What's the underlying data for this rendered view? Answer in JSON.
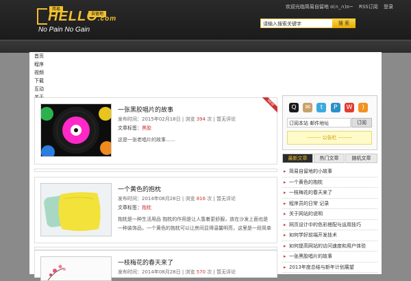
{
  "header": {
    "logo_text": "HELLO",
    "logo_badge_left": "简易",
    "logo_badge_right": "自留地",
    "logo_com": ".com",
    "tagline": "No Pain No Gain",
    "top_text": "欢迎光临简易自留地 o(∩_∩)o~",
    "rss_label": "RSS订阅",
    "login_label": "登录"
  },
  "search": {
    "placeholder": "请输入搜索关键字",
    "button_label": "搜 索"
  },
  "menu": [
    "首页",
    "程序",
    "视频",
    "下载",
    "互动",
    "关于"
  ],
  "posts": [
    {
      "title": "一张黑胶唱片的故事",
      "date_label": "发布时间：2015年02月18日",
      "views_prefix": "浏览",
      "views": "394",
      "views_suffix": "次",
      "comments_label": "暂无评论",
      "tags_label": "文章标签：",
      "tag": "黑胶",
      "description": "这是一张老唱片的故事……",
      "badge": "NEW"
    },
    {
      "title": "一个黄色的抱枕",
      "date_label": "发布时间：2014年08月28日",
      "views_prefix": "浏览",
      "views": "816",
      "views_suffix": "次",
      "comments_label": "暂无评论",
      "tags_label": "文章标签：",
      "tag": "抱枕",
      "description": "抱枕是一种生活用品 抱枕的作用是让人靠着更舒服，放在沙发上面也是一种装饰品，一个黄色的抱枕可以让房间显得温馨明亮，这里是一段简单的文字介绍 抱枕的材质有很多种，大家可以根据自己的喜好来选择适合自己的……"
    },
    {
      "title": "一枝梅花的春天来了",
      "date_label": "发布时间：2014年08月28日",
      "views_prefix": "浏览",
      "views": "570",
      "views_suffix": "次",
      "comments_label": "暂无评论"
    }
  ],
  "sidebar": {
    "social_icons": [
      "qq-icon",
      "email-icon",
      "twitter-icon",
      "pinterest-icon",
      "weibo-icon",
      "rss-icon"
    ],
    "subscribe_placeholder": "订阅本站 邮件地址",
    "subscribe_button": "订阅",
    "notice": "-------- 公告栏 --------",
    "tabs": [
      "最新文章",
      "热门文章",
      "随机文章"
    ],
    "list": [
      "简易自留地的小故事",
      "一个黄色的抱枕",
      "一枝梅花的春天来了",
      "程序员的日常 记录",
      "关于网站的说明",
      "网页设计中的色彩搭配与运用技巧",
      "如何学好前端开发技术",
      "如何提高网站的访问速度和用户体验",
      "一张黑胶唱片的故事",
      "2013年度总结与新年计划展望"
    ]
  },
  "colors": {
    "accent": "#f2c12e",
    "header_bg": "#222222",
    "hot": "#cc3333"
  }
}
